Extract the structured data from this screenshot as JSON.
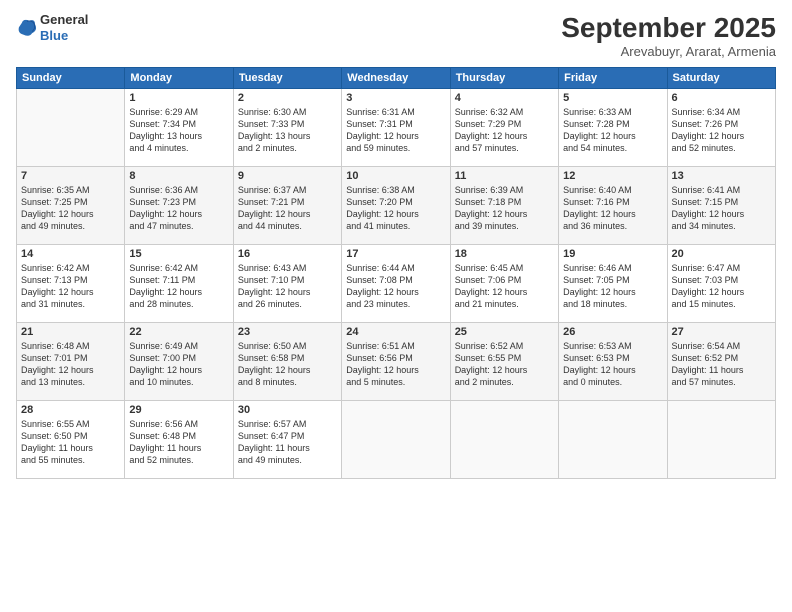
{
  "logo": {
    "general": "General",
    "blue": "Blue"
  },
  "header": {
    "month": "September 2025",
    "location": "Arevabuyr, Ararat, Armenia"
  },
  "days_of_week": [
    "Sunday",
    "Monday",
    "Tuesday",
    "Wednesday",
    "Thursday",
    "Friday",
    "Saturday"
  ],
  "weeks": [
    [
      {
        "day": "",
        "info": ""
      },
      {
        "day": "1",
        "info": "Sunrise: 6:29 AM\nSunset: 7:34 PM\nDaylight: 13 hours\nand 4 minutes."
      },
      {
        "day": "2",
        "info": "Sunrise: 6:30 AM\nSunset: 7:33 PM\nDaylight: 13 hours\nand 2 minutes."
      },
      {
        "day": "3",
        "info": "Sunrise: 6:31 AM\nSunset: 7:31 PM\nDaylight: 12 hours\nand 59 minutes."
      },
      {
        "day": "4",
        "info": "Sunrise: 6:32 AM\nSunset: 7:29 PM\nDaylight: 12 hours\nand 57 minutes."
      },
      {
        "day": "5",
        "info": "Sunrise: 6:33 AM\nSunset: 7:28 PM\nDaylight: 12 hours\nand 54 minutes."
      },
      {
        "day": "6",
        "info": "Sunrise: 6:34 AM\nSunset: 7:26 PM\nDaylight: 12 hours\nand 52 minutes."
      }
    ],
    [
      {
        "day": "7",
        "info": "Sunrise: 6:35 AM\nSunset: 7:25 PM\nDaylight: 12 hours\nand 49 minutes."
      },
      {
        "day": "8",
        "info": "Sunrise: 6:36 AM\nSunset: 7:23 PM\nDaylight: 12 hours\nand 47 minutes."
      },
      {
        "day": "9",
        "info": "Sunrise: 6:37 AM\nSunset: 7:21 PM\nDaylight: 12 hours\nand 44 minutes."
      },
      {
        "day": "10",
        "info": "Sunrise: 6:38 AM\nSunset: 7:20 PM\nDaylight: 12 hours\nand 41 minutes."
      },
      {
        "day": "11",
        "info": "Sunrise: 6:39 AM\nSunset: 7:18 PM\nDaylight: 12 hours\nand 39 minutes."
      },
      {
        "day": "12",
        "info": "Sunrise: 6:40 AM\nSunset: 7:16 PM\nDaylight: 12 hours\nand 36 minutes."
      },
      {
        "day": "13",
        "info": "Sunrise: 6:41 AM\nSunset: 7:15 PM\nDaylight: 12 hours\nand 34 minutes."
      }
    ],
    [
      {
        "day": "14",
        "info": "Sunrise: 6:42 AM\nSunset: 7:13 PM\nDaylight: 12 hours\nand 31 minutes."
      },
      {
        "day": "15",
        "info": "Sunrise: 6:42 AM\nSunset: 7:11 PM\nDaylight: 12 hours\nand 28 minutes."
      },
      {
        "day": "16",
        "info": "Sunrise: 6:43 AM\nSunset: 7:10 PM\nDaylight: 12 hours\nand 26 minutes."
      },
      {
        "day": "17",
        "info": "Sunrise: 6:44 AM\nSunset: 7:08 PM\nDaylight: 12 hours\nand 23 minutes."
      },
      {
        "day": "18",
        "info": "Sunrise: 6:45 AM\nSunset: 7:06 PM\nDaylight: 12 hours\nand 21 minutes."
      },
      {
        "day": "19",
        "info": "Sunrise: 6:46 AM\nSunset: 7:05 PM\nDaylight: 12 hours\nand 18 minutes."
      },
      {
        "day": "20",
        "info": "Sunrise: 6:47 AM\nSunset: 7:03 PM\nDaylight: 12 hours\nand 15 minutes."
      }
    ],
    [
      {
        "day": "21",
        "info": "Sunrise: 6:48 AM\nSunset: 7:01 PM\nDaylight: 12 hours\nand 13 minutes."
      },
      {
        "day": "22",
        "info": "Sunrise: 6:49 AM\nSunset: 7:00 PM\nDaylight: 12 hours\nand 10 minutes."
      },
      {
        "day": "23",
        "info": "Sunrise: 6:50 AM\nSunset: 6:58 PM\nDaylight: 12 hours\nand 8 minutes."
      },
      {
        "day": "24",
        "info": "Sunrise: 6:51 AM\nSunset: 6:56 PM\nDaylight: 12 hours\nand 5 minutes."
      },
      {
        "day": "25",
        "info": "Sunrise: 6:52 AM\nSunset: 6:55 PM\nDaylight: 12 hours\nand 2 minutes."
      },
      {
        "day": "26",
        "info": "Sunrise: 6:53 AM\nSunset: 6:53 PM\nDaylight: 12 hours\nand 0 minutes."
      },
      {
        "day": "27",
        "info": "Sunrise: 6:54 AM\nSunset: 6:52 PM\nDaylight: 11 hours\nand 57 minutes."
      }
    ],
    [
      {
        "day": "28",
        "info": "Sunrise: 6:55 AM\nSunset: 6:50 PM\nDaylight: 11 hours\nand 55 minutes."
      },
      {
        "day": "29",
        "info": "Sunrise: 6:56 AM\nSunset: 6:48 PM\nDaylight: 11 hours\nand 52 minutes."
      },
      {
        "day": "30",
        "info": "Sunrise: 6:57 AM\nSunset: 6:47 PM\nDaylight: 11 hours\nand 49 minutes."
      },
      {
        "day": "",
        "info": ""
      },
      {
        "day": "",
        "info": ""
      },
      {
        "day": "",
        "info": ""
      },
      {
        "day": "",
        "info": ""
      }
    ]
  ]
}
